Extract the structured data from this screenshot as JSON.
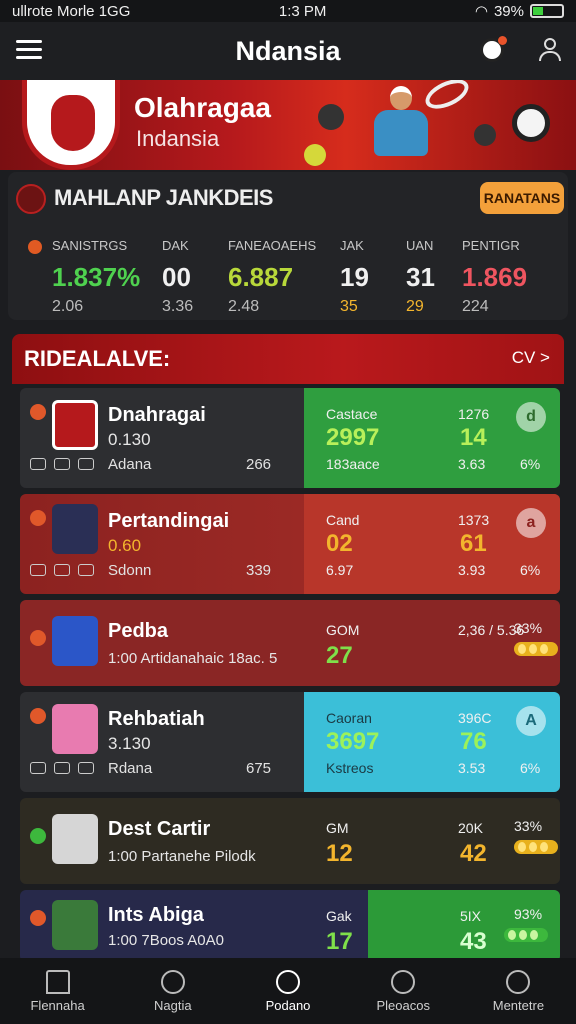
{
  "status": {
    "carrier": "ullrote Morle 1GG",
    "time": "1:3 PM",
    "battery": "39%"
  },
  "appbar": {
    "title": "Ndansia",
    "icons": [
      "menu-icon",
      "soccer-ball-icon",
      "user-icon"
    ]
  },
  "banner": {
    "title": "Olahragaa",
    "subtitle": "Indansia"
  },
  "stats": {
    "title": "MAHLANP JANKDEIS",
    "action": "RANATANS",
    "items": [
      {
        "label": "SANISTRGS",
        "big": "1.837%",
        "small": "2.06",
        "color": "#4fd14f"
      },
      {
        "label": "DAK",
        "big": "00",
        "small": "3.36",
        "color": "#f0f0f0"
      },
      {
        "label": "FANEAOAEHS",
        "big": "6.887",
        "small": "2.48",
        "color": "#b8d83a"
      },
      {
        "label": "JAK",
        "big": "19",
        "small": "35",
        "color": "#f0f0f0",
        "small_color": "#f3b52d"
      },
      {
        "label": "UAN",
        "big": "31",
        "small": "29",
        "color": "#f0f0f0",
        "small_color": "#f3b52d"
      },
      {
        "label": "PENTIGR",
        "big": "1.869",
        "small": "224",
        "color": "#ef5560"
      }
    ]
  },
  "section": {
    "title": "RIDEALALVE:",
    "action": "CV >"
  },
  "cards": [
    {
      "name": "Dnahragai",
      "sub": "0.130",
      "foot": "Adana",
      "num": "266",
      "r_label": "Castace",
      "r_big": "2997",
      "r_big2": "14",
      "r_foot": "183aace",
      "r_foot2": "3.63",
      "r_foot3": "6%",
      "badge": "d",
      "r_color": "#2f9e3f",
      "big_color": "#b8f05a"
    },
    {
      "name": "Pertandingai",
      "sub": "0.60",
      "foot": "Sdonn",
      "num": "339",
      "r_label": "Cand",
      "r_big": "02",
      "r_big2": "61",
      "r_foot": "6.97",
      "r_foot2": "3.93",
      "r_foot3": "6%",
      "badge": "a",
      "r_color": "#b8362a",
      "big_color": "#f3b52d"
    },
    {
      "name": "Pedba",
      "sub": "1:00 Artidanahaic 18ac. 5",
      "foot": "",
      "num": "",
      "r_label": "GOM",
      "r_big": "27",
      "r_big2": "",
      "r_foot": "",
      "r_foot2": "2,36 / 5.36",
      "r_foot3": "33%",
      "badge": "",
      "r_color": "#8a2625",
      "big_color": "#7fe04a"
    },
    {
      "name": "Rehbatiah",
      "sub": "3.130",
      "foot": "Rdana",
      "num": "675",
      "r_label": "Caoran",
      "r_big": "3697",
      "r_big2": "76",
      "r_foot": "Kstreos",
      "r_foot2": "3.53",
      "r_foot3": "6%",
      "badge": "A",
      "r_color": "#3bbfd8",
      "big_color": "#9cf25a"
    },
    {
      "name": "Dest Cartir",
      "sub": "1:00 Partanehe Pilodk",
      "foot": "",
      "num": "",
      "r_label": "GM",
      "r_big": "12",
      "r_big2": "42",
      "r_foot": "",
      "r_foot2": "20K",
      "r_foot3": "33%",
      "badge": "",
      "r_color": "#2e2b22",
      "big_color": "#f3b52d"
    },
    {
      "name": "Ints Abiga",
      "sub": "1:00 7Boos A0A0",
      "foot": "",
      "num": "",
      "r_label": "Gak",
      "r_big": "17",
      "r_big2": "43",
      "r_foot": "",
      "r_foot2": "5IX",
      "r_foot3": "93%",
      "badge": "",
      "r_color": "#2c9a38",
      "big_color": "#7fe04a"
    }
  ],
  "bottom_nav": [
    {
      "label": "Flennaha",
      "icon": "home-icon"
    },
    {
      "label": "Nagtia",
      "icon": "ball-icon"
    },
    {
      "label": "Podano",
      "icon": "plus-circle-icon"
    },
    {
      "label": "Pleoacos",
      "icon": "soccer-ball-icon"
    },
    {
      "label": "Mentetre",
      "icon": "user-icon"
    }
  ]
}
